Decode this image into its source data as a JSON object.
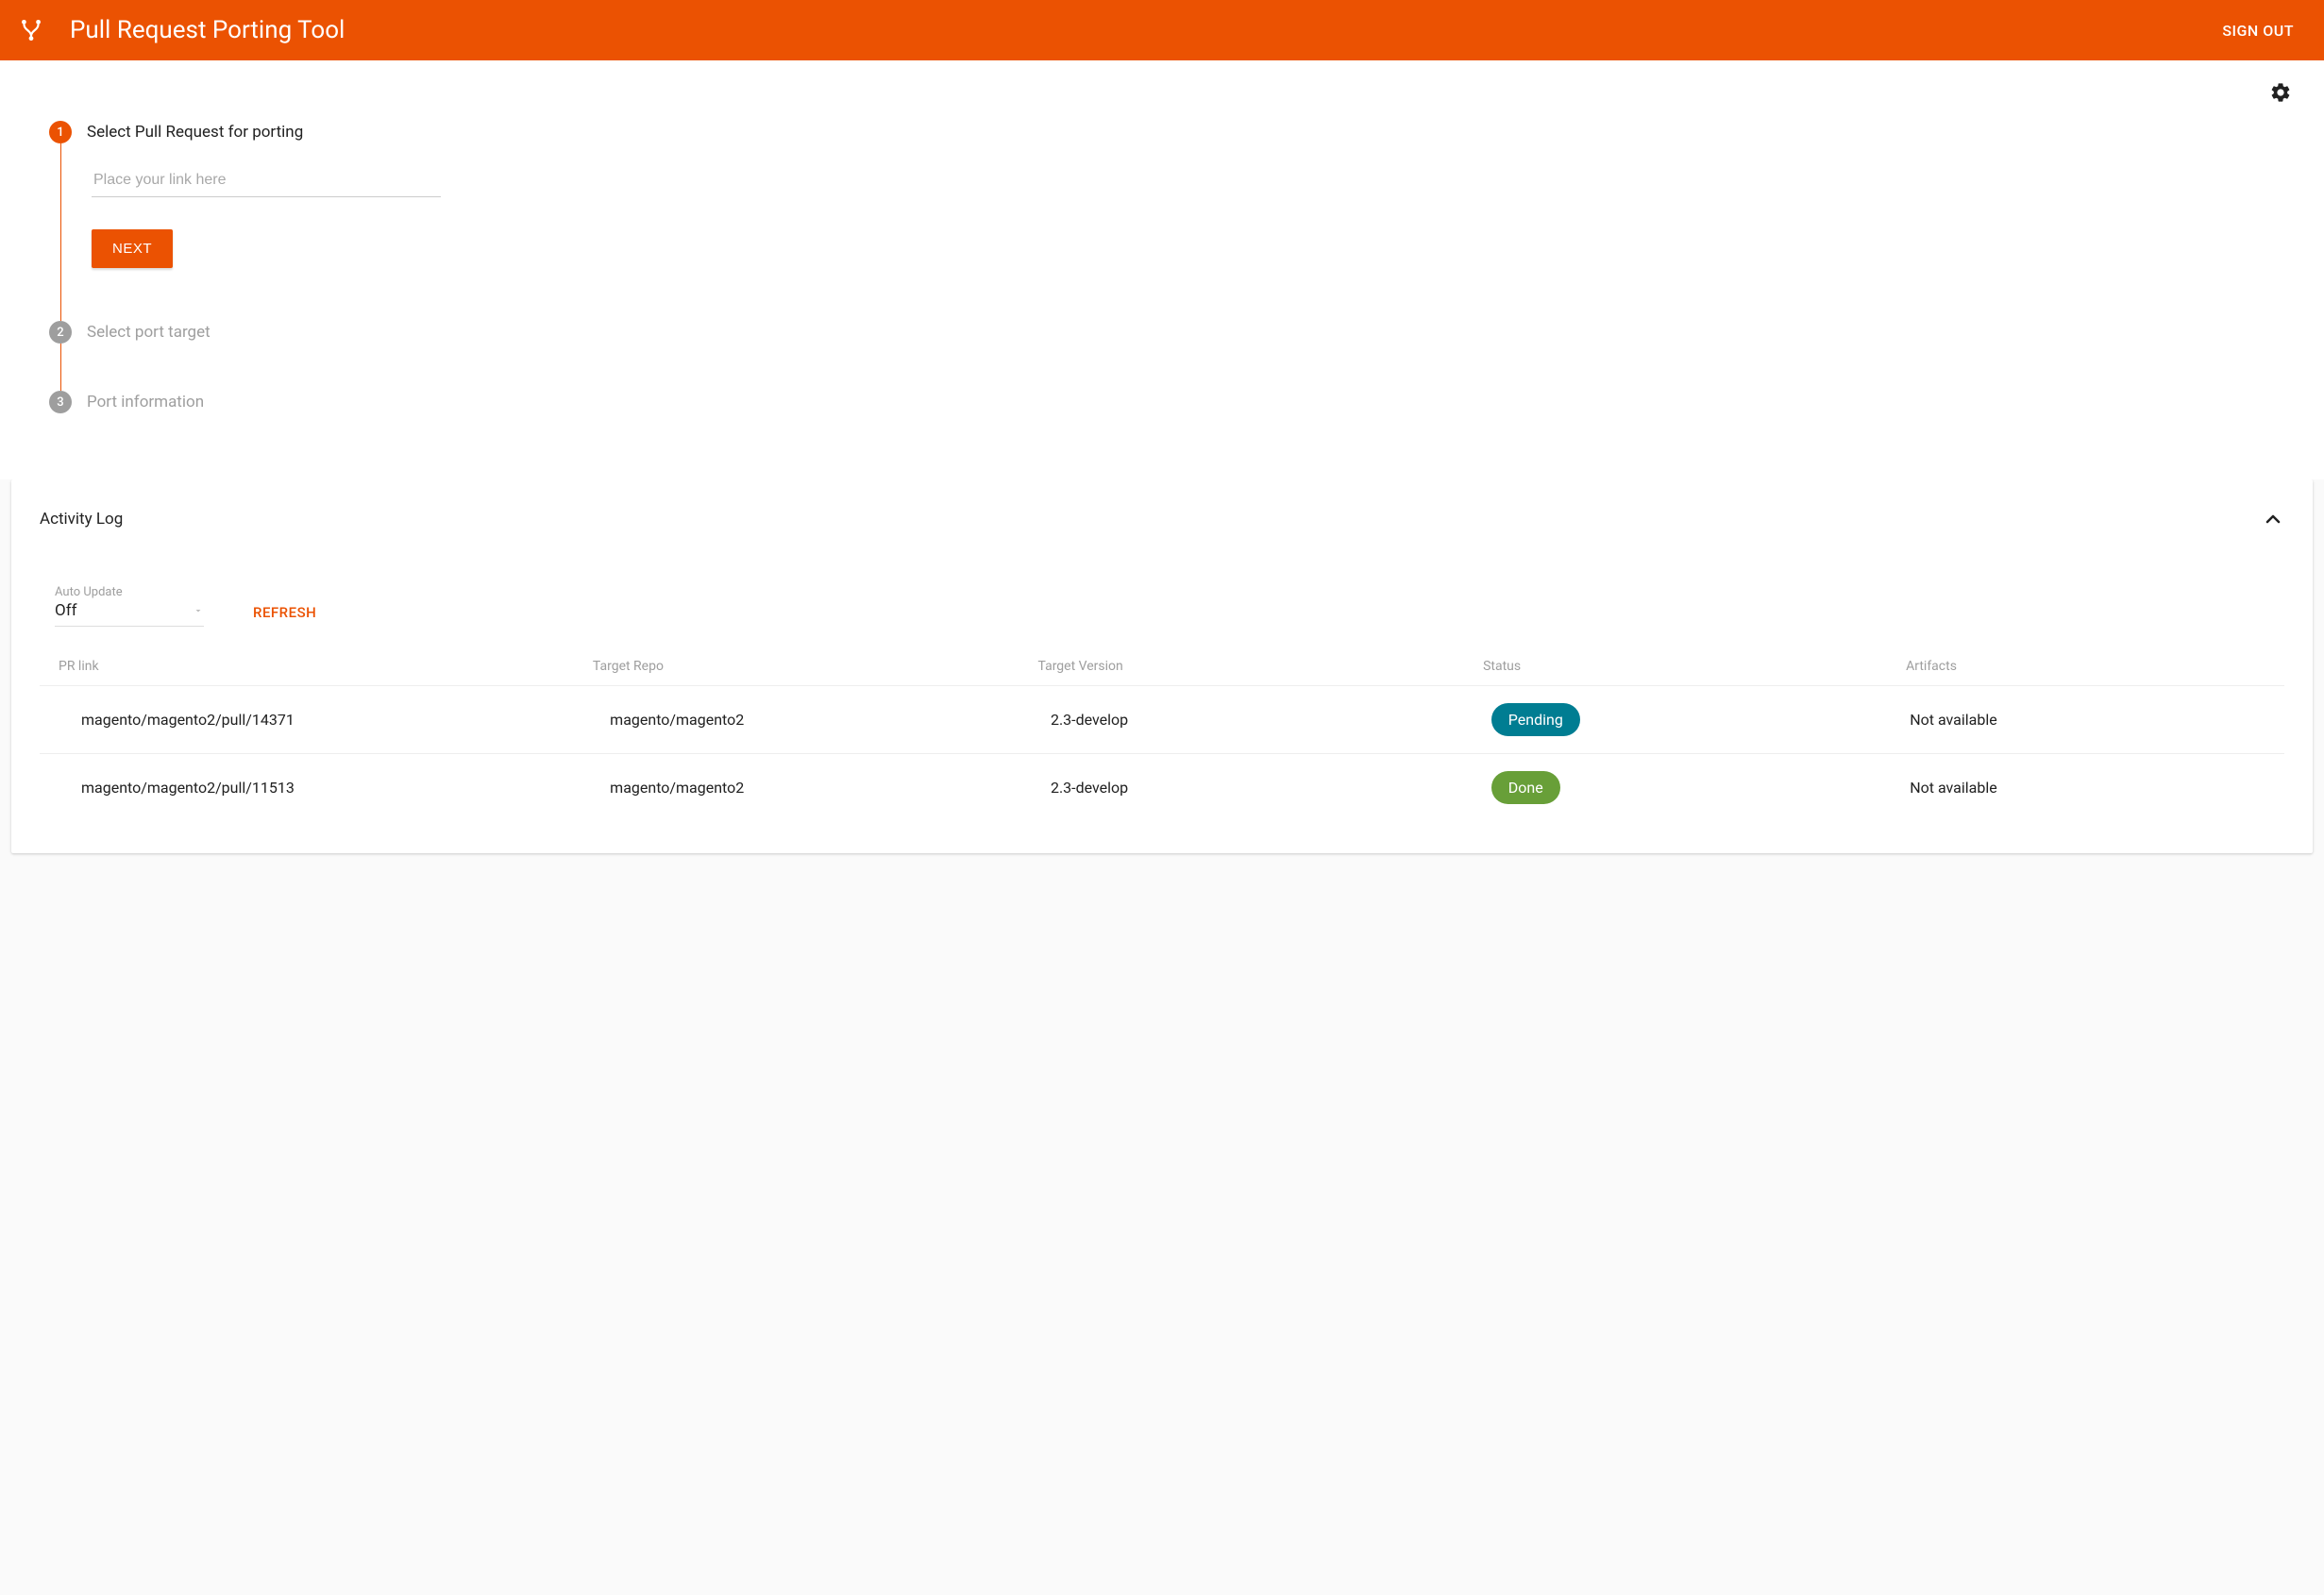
{
  "header": {
    "title": "Pull Request Porting Tool",
    "sign_out": "SIGN OUT"
  },
  "stepper": {
    "step1": {
      "number": "1",
      "label": "Select Pull Request for porting",
      "input_placeholder": "Place your link here",
      "next_label": "NEXT"
    },
    "step2": {
      "number": "2",
      "label": "Select port target"
    },
    "step3": {
      "number": "3",
      "label": "Port information"
    }
  },
  "activity": {
    "title": "Activity Log",
    "auto_update_label": "Auto Update",
    "auto_update_value": "Off",
    "refresh_label": "REFRESH",
    "columns": {
      "pr_link": "PR link",
      "target_repo": "Target Repo",
      "target_version": "Target Version",
      "status": "Status",
      "artifacts": "Artifacts"
    },
    "rows": [
      {
        "pr_link": "magento/magento2/pull/14371",
        "target_repo": "magento/magento2",
        "target_version": "2.3-develop",
        "status": "Pending",
        "status_class": "pending",
        "artifacts": "Not available"
      },
      {
        "pr_link": "magento/magento2/pull/11513",
        "target_repo": "magento/magento2",
        "target_version": "2.3-develop",
        "status": "Done",
        "status_class": "done",
        "artifacts": "Not available"
      }
    ]
  }
}
